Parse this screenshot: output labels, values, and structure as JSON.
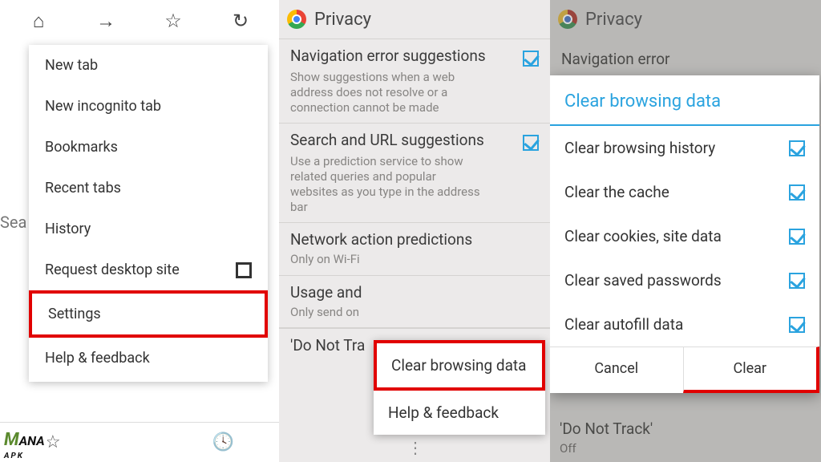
{
  "panel1": {
    "search_fragment": "Sea",
    "menu": [
      "New tab",
      "New incognito tab",
      "Bookmarks",
      "Recent tabs",
      "History",
      "Request desktop site",
      "Settings",
      "Help & feedback"
    ]
  },
  "panel2": {
    "header": "Privacy",
    "settings": [
      {
        "title": "Navigation error suggestions",
        "desc": "Show suggestions when a web address does not resolve or a connection cannot be made",
        "checked": true
      },
      {
        "title": "Search and URL suggestions",
        "desc": "Use a prediction service to show related queries and popular websites as you type in the address bar",
        "checked": true
      },
      {
        "title": "Network action predictions",
        "desc": "Only on Wi-Fi"
      },
      {
        "title": "Usage and",
        "desc": "Only send on"
      },
      {
        "title": "'Do Not Tra"
      }
    ],
    "popup": [
      "Clear browsing data",
      "Help & feedback"
    ]
  },
  "panel3": {
    "header": "Privacy",
    "bg_text": "Navigation error",
    "dialog": {
      "title": "Clear browsing data",
      "items": [
        "Clear browsing history",
        "Clear the cache",
        "Clear cookies, site data",
        "Clear saved passwords",
        "Clear autofill data"
      ],
      "cancel": "Cancel",
      "clear": "Clear"
    },
    "bottom_title": "'Do Not Track'",
    "bottom_sub": "Off"
  },
  "watermark": {
    "m": "M",
    "rest": "ANA",
    "sub": "APK"
  }
}
